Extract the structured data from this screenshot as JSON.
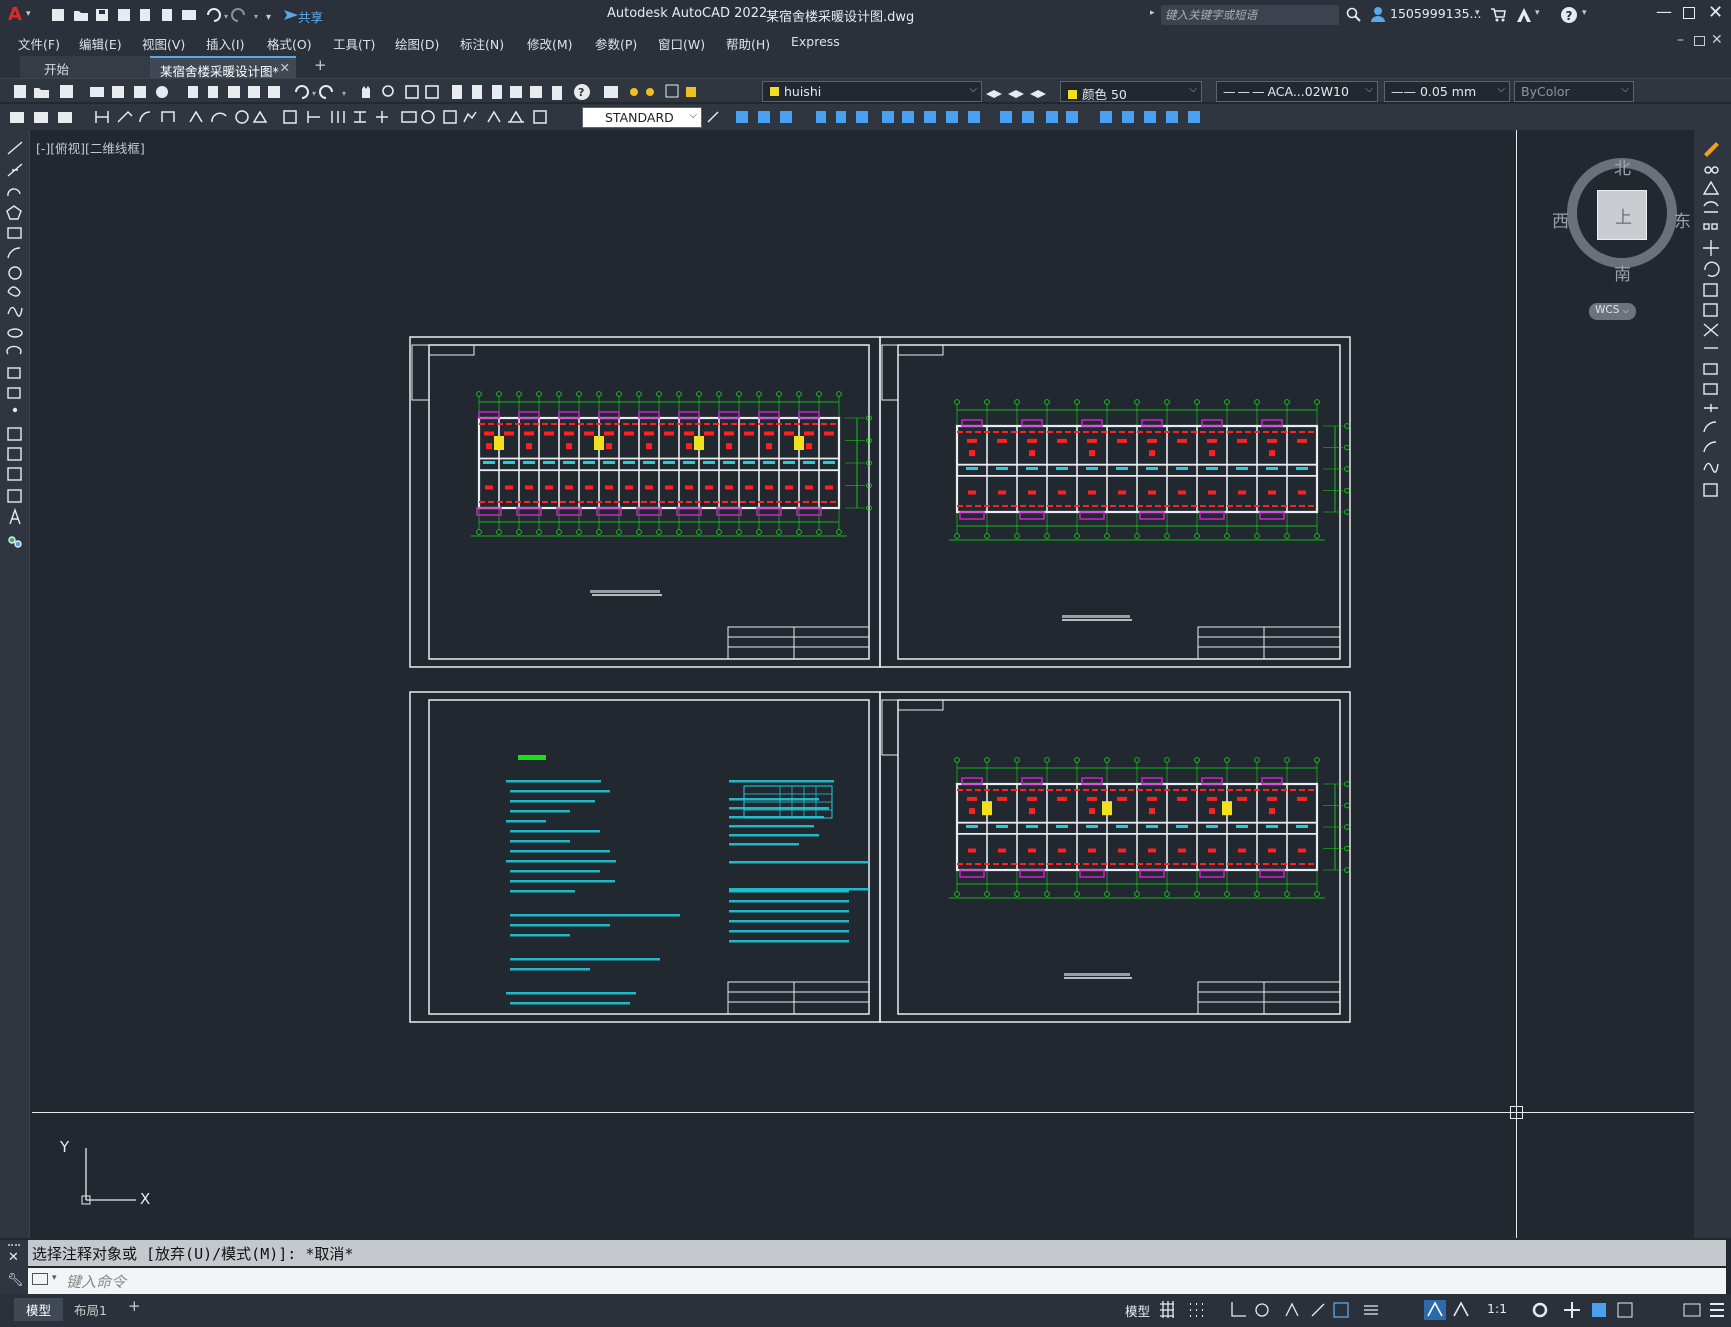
{
  "app": {
    "title": "Autodesk AutoCAD 2022",
    "file": "某宿舍楼采暖设计图.dwg",
    "share": "共享",
    "search_placeholder": "键入关键字或短语",
    "user": "1505999135...",
    "logo": "A"
  },
  "menu": [
    "文件(F)",
    "编辑(E)",
    "视图(V)",
    "插入(I)",
    "格式(O)",
    "工具(T)",
    "绘图(D)",
    "标注(N)",
    "修改(M)",
    "参数(P)",
    "窗口(W)",
    "帮助(H)",
    "Express"
  ],
  "tabs": {
    "start": "开始",
    "active": "某宿舍楼采暖设计图*",
    "add": "+"
  },
  "toolbar": {
    "layer": "huishi",
    "color": "颜色 50",
    "linetype": "ACA...02W10",
    "lineweight": "0.05 mm",
    "plotstyle": "ByColor",
    "textstyle": "STANDARD"
  },
  "viewport": {
    "label": "[-][俯视][二维线框]"
  },
  "viewcube": {
    "north": "北",
    "south": "南",
    "east": "东",
    "west": "西",
    "face": "上",
    "wcs": "WCS"
  },
  "ucs": {
    "x": "X",
    "y": "Y"
  },
  "command": {
    "history": "选择注释对象或 [放弃(U)/模式(M)]: *取消*",
    "placeholder": "键入命令"
  },
  "layout_tabs": [
    "模型",
    "布局1",
    "+"
  ],
  "status": {
    "model": "模型",
    "scale": "1:1"
  },
  "colors": {
    "bg": "#212830",
    "green": "#16e016",
    "red": "#ff2020",
    "magenta": "#d020d0",
    "cyan": "#20d0e0",
    "yellow": "#f0e020"
  }
}
